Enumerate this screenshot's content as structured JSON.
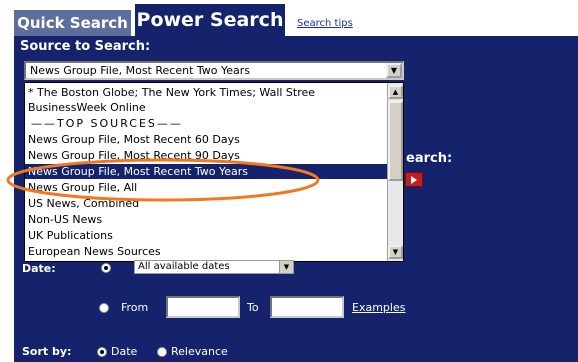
{
  "tabs": {
    "quick_search": "Quick Search",
    "power_search": "Power Search",
    "search_tips": "Search tips"
  },
  "source": {
    "label": "Source to Search:",
    "selected_value": "News Group File, Most Recent Two Years",
    "options": [
      "* The Boston Globe; The New York Times; Wall Stree",
      "BusinessWeek Online",
      "——TOP SOURCES——",
      "News Group File, Most Recent 60 Days",
      "News Group File, Most Recent 90 Days",
      "News Group File, Most Recent Two Years",
      "News Group File, All",
      "US News, Combined",
      "Non-US News",
      "UK Publications",
      "European News Sources"
    ],
    "highlighted_option": "News Group File, Most Recent Two Years"
  },
  "search": {
    "label_fragment": "earch:"
  },
  "date": {
    "label": "Date:",
    "range_select_value": "All available dates",
    "from_label": "From",
    "to_label": "To",
    "from_value": "",
    "to_value": "",
    "examples_link": "Examples"
  },
  "sort": {
    "label": "Sort by:",
    "options": [
      "Date",
      "Relevance"
    ],
    "selected": "Date"
  },
  "colors": {
    "panel_navy": "#14236b",
    "tab_inactive": "#5d6e9c",
    "highlight": "#14236b",
    "annotation_orange": "#f07820",
    "search_button_red": "#c0201e"
  },
  "icons": {
    "dropdown_arrow": "chevron-down-icon",
    "scroll_up": "scroll-up-icon",
    "scroll_down": "scroll-down-icon",
    "search_submit": "arrow-right-icon"
  }
}
